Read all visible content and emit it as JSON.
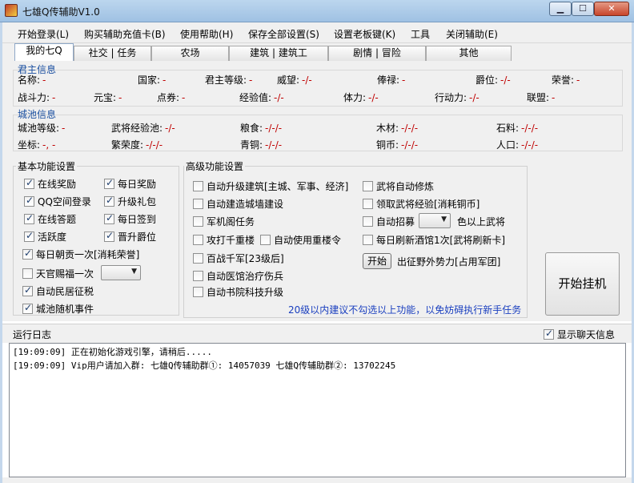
{
  "window": {
    "title": "七雄Q传辅助V1.0",
    "min": "▁",
    "max": "☐",
    "close": "✕"
  },
  "menu": [
    "开始登录(L)",
    "购买辅助充值卡(B)",
    "使用帮助(H)",
    "保存全部设置(S)",
    "设置老板键(K)",
    "工具",
    "关闭辅助(E)"
  ],
  "tabs": [
    "我的七Q",
    "社交 | 任务",
    "农场",
    "建筑 | 建筑工",
    "剧情 | 冒险",
    "其他"
  ],
  "lord": {
    "heading": "君主信息",
    "row1": [
      {
        "label": "名称:",
        "value": "-"
      },
      {
        "label": "国家:",
        "value": "-"
      },
      {
        "label": "君主等级:",
        "value": "-"
      },
      {
        "label": "威望:",
        "value": "-/-"
      },
      {
        "label": "俸禄:",
        "value": "-"
      },
      {
        "label": "爵位:",
        "value": "-/-"
      },
      {
        "label": "荣誉:",
        "value": "-"
      }
    ],
    "row2": [
      {
        "label": "战斗力:",
        "value": "-"
      },
      {
        "label": "元宝:",
        "value": "-"
      },
      {
        "label": "点券:",
        "value": "-"
      },
      {
        "label": "经验值:",
        "value": "-/-"
      },
      {
        "label": "体力:",
        "value": "-/-"
      },
      {
        "label": "行动力:",
        "value": "-/-"
      },
      {
        "label": "联盟:",
        "value": "-"
      }
    ]
  },
  "city": {
    "heading": "城池信息",
    "row1": [
      {
        "label": "城池等级:",
        "value": "-"
      },
      {
        "label": "武将经验池:",
        "value": "-/-"
      },
      {
        "label": "粮食:",
        "value": "-/-/-"
      },
      {
        "label": "木材:",
        "value": "-/-/-"
      },
      {
        "label": "石料:",
        "value": "-/-/-"
      }
    ],
    "row2": [
      {
        "label": "坐标:",
        "value": "-, -"
      },
      {
        "label": "繁荣度:",
        "value": "-/-/-"
      },
      {
        "label": "青铜:",
        "value": "-/-/-"
      },
      {
        "label": "铜币:",
        "value": "-/-/-"
      },
      {
        "label": "人口:",
        "value": "-/-/-"
      }
    ]
  },
  "basic": {
    "heading": "基本功能设置",
    "items": [
      {
        "label": "在线奖励",
        "checked": true
      },
      {
        "label": "每日奖励",
        "checked": true
      },
      {
        "label": "QQ空间登录",
        "checked": true
      },
      {
        "label": "升级礼包",
        "checked": true
      },
      {
        "label": "在线答题",
        "checked": true
      },
      {
        "label": "每日签到",
        "checked": true
      },
      {
        "label": "活跃度",
        "checked": true
      },
      {
        "label": "晋升爵位",
        "checked": true
      },
      {
        "label": "每日朝贡一次[消耗荣誉]",
        "checked": true
      },
      {
        "label": "天官赐福一次",
        "checked": false
      },
      {
        "label": "自动民居征税",
        "checked": true
      },
      {
        "label": "城池随机事件",
        "checked": true
      }
    ],
    "blessing_select": ""
  },
  "advanced": {
    "heading": "高级功能设置",
    "items": [
      {
        "label": "自动升级建筑[主城、军事、经济]",
        "checked": false
      },
      {
        "label": "武将自动修炼",
        "checked": false
      },
      {
        "label": "自动建造城墙建设",
        "checked": false
      },
      {
        "label": "领取武将经验[消耗铜币]",
        "checked": false
      },
      {
        "label": "军机阁任务",
        "checked": false
      },
      {
        "label": "自动招募",
        "checked": false
      },
      {
        "label": "攻打千重楼",
        "checked": false
      },
      {
        "label": "自动使用重楼令",
        "checked": false
      },
      {
        "label": "每日刷新酒馆1次[武将刷新卡]",
        "checked": false
      },
      {
        "label": "百战千军[23级后]",
        "checked": false
      },
      {
        "label": "自动医馆治疗伤兵",
        "checked": false
      },
      {
        "label": "自动书院科技升级",
        "checked": false
      }
    ],
    "recruit_select": "",
    "recruit_suffix": "色以上武将",
    "start_label": "开始",
    "expedition_label": "出征野外势力[占用军团]",
    "note": "20级以内建议不勾选以上功能，以免妨碍执行新手任务"
  },
  "main_button": "开始挂机",
  "log": {
    "label": "运行日志",
    "show_chat": {
      "label": "显示聊天信息",
      "checked": true
    },
    "lines": [
      "[19:09:09] 正在初始化游戏引擎，请稍后.....",
      "[19:09:09] Vip用户请加入群: 七雄Q传辅助群①: 14057039    七雄Q传辅助群②: 13702245"
    ]
  }
}
